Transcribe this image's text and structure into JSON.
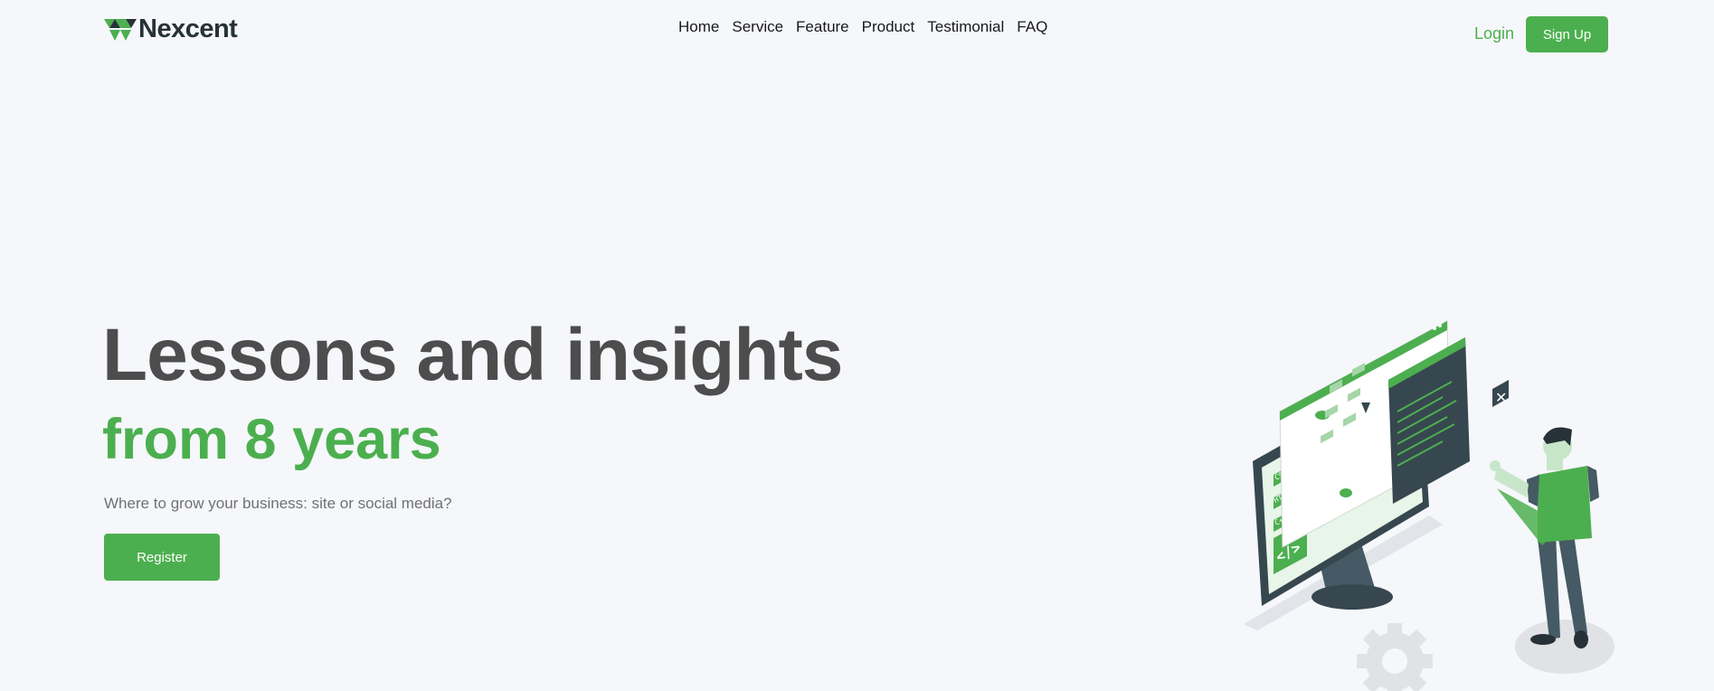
{
  "brand": {
    "name": "Nexcent"
  },
  "nav": {
    "items": [
      "Home",
      "Service",
      "Feature",
      "Product",
      "Testimonial",
      "FAQ"
    ]
  },
  "auth": {
    "login_label": "Login",
    "signup_label": "Sign Up"
  },
  "hero": {
    "title": "Lessons and insights",
    "subtitle": "from 8 years",
    "description": "Where to grow your business: site or social media?",
    "cta_label": "Register"
  },
  "illustration": {
    "tags": [
      "CSS",
      "HTML",
      "C++"
    ],
    "code_glyph": "</>"
  },
  "colors": {
    "brand_green": "#4caf4f",
    "dark_text": "#263238",
    "title_gray": "#4d4d4d",
    "body_gray": "#717171",
    "background": "#f5f7fa"
  }
}
